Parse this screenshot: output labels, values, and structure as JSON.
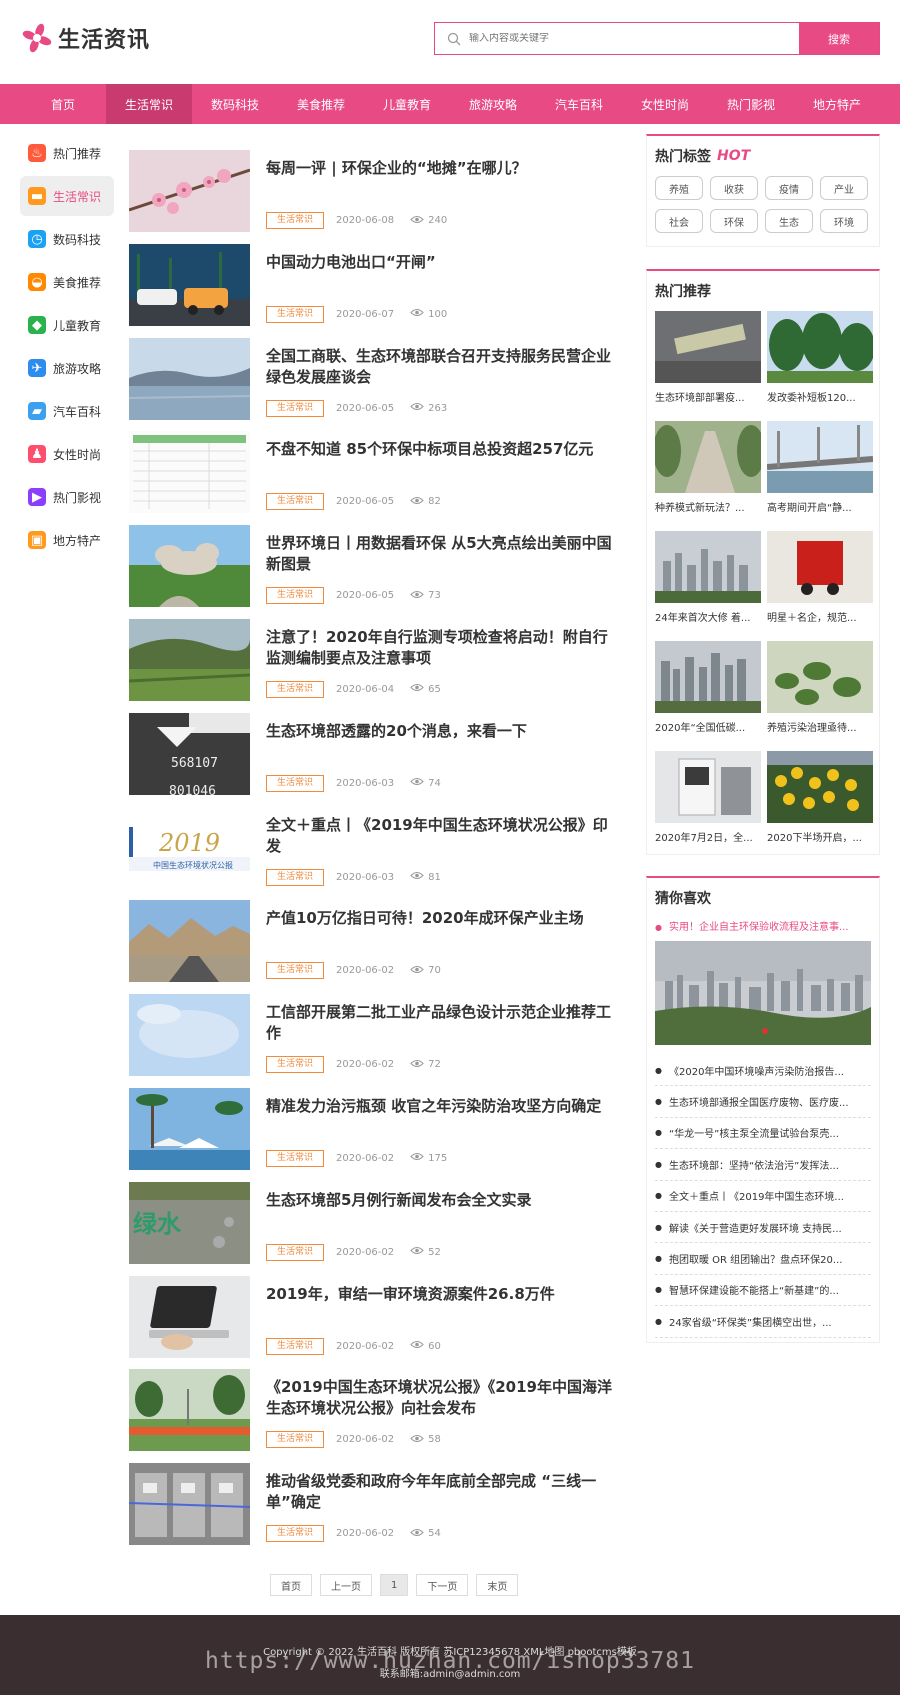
{
  "site": {
    "logo_text": "生活资讯",
    "accent": "#e84b84"
  },
  "search": {
    "placeholder": "输入内容或关键字",
    "button": "搜索"
  },
  "nav": [
    "首页",
    "生活常识",
    "数码科技",
    "美食推荐",
    "儿童教育",
    "旅游攻略",
    "汽车百科",
    "女性时尚",
    "热门影视",
    "地方特产"
  ],
  "nav_active": "生活常识",
  "sidebar": [
    {
      "label": "热门推荐",
      "icon": "flame-icon",
      "color": "#ff5a3c"
    },
    {
      "label": "生活常识",
      "icon": "sofa-icon",
      "color": "#ff9a1f"
    },
    {
      "label": "数码科技",
      "icon": "clock-icon",
      "color": "#1da1f2"
    },
    {
      "label": "美食推荐",
      "icon": "cloche-icon",
      "color": "#ff8a00"
    },
    {
      "label": "儿童教育",
      "icon": "graduation-cap-icon",
      "color": "#2bb24c"
    },
    {
      "label": "旅游攻略",
      "icon": "airplane-icon",
      "color": "#2d8cf0"
    },
    {
      "label": "汽车百科",
      "icon": "car-icon",
      "color": "#3ba0f0"
    },
    {
      "label": "女性时尚",
      "icon": "high-heel-icon",
      "color": "#ff4d6d"
    },
    {
      "label": "热门影视",
      "icon": "play-icon",
      "color": "#8a3ffc"
    },
    {
      "label": "地方特产",
      "icon": "box-icon",
      "color": "#ff9a1f"
    }
  ],
  "articles": [
    {
      "title": "每周一评 | 环保企业的“地摊”在哪儿？",
      "tag": "生活常识",
      "date": "2020-06-08",
      "views": "240"
    },
    {
      "title": "中国动力电池出口“开闸”",
      "tag": "生活常识",
      "date": "2020-06-07",
      "views": "100"
    },
    {
      "title": "全国工商联、生态环境部联合召开支持服务民营企业绿色发展座谈会",
      "tag": "生活常识",
      "date": "2020-06-05",
      "views": "263"
    },
    {
      "title": "不盘不知道 85个环保中标项目总投资超257亿元",
      "tag": "生活常识",
      "date": "2020-06-05",
      "views": "82"
    },
    {
      "title": "世界环境日丨用数据看环保 从5大亮点绘出美丽中国新图景",
      "tag": "生活常识",
      "date": "2020-06-05",
      "views": "73"
    },
    {
      "title": "注意了！2020年自行监测专项检查将启动！附自行监测编制要点及注意事项",
      "tag": "生活常识",
      "date": "2020-06-04",
      "views": "65"
    },
    {
      "title": "生态环境部透露的20个消息，来看一下",
      "tag": "生活常识",
      "date": "2020-06-03",
      "views": "74"
    },
    {
      "title": "全文＋重点丨《2019年中国生态环境状况公报》印发",
      "tag": "生活常识",
      "date": "2020-06-03",
      "views": "81"
    },
    {
      "title": "产值10万亿指日可待！2020年成环保产业主场",
      "tag": "生活常识",
      "date": "2020-06-02",
      "views": "70"
    },
    {
      "title": "工信部开展第二批工业产品绿色设计示范企业推荐工作",
      "tag": "生活常识",
      "date": "2020-06-02",
      "views": "72"
    },
    {
      "title": "精准发力治污瓶颈 收官之年污染防治攻坚方向确定",
      "tag": "生活常识",
      "date": "2020-06-02",
      "views": "175"
    },
    {
      "title": "生态环境部5月例行新闻发布会全文实录",
      "tag": "生活常识",
      "date": "2020-06-02",
      "views": "52"
    },
    {
      "title": "2019年，审结一审环境资源案件26.8万件",
      "tag": "生活常识",
      "date": "2020-06-02",
      "views": "60"
    },
    {
      "title": "《2019中国生态环境状况公报》《2019年中国海洋生态环境状况公报》向社会发布",
      "tag": "生活常识",
      "date": "2020-06-02",
      "views": "58"
    },
    {
      "title": "推动省级党委和政府今年年底前全部完成 “三线一单”确定",
      "tag": "生活常识",
      "date": "2020-06-02",
      "views": "54"
    }
  ],
  "pager": {
    "first": "首页",
    "prev": "上一页",
    "current": "1",
    "next": "下一页",
    "last": "末页"
  },
  "hot_tags": {
    "title": "热门标签",
    "hot_label": "HOT",
    "tags": [
      "养殖",
      "收获",
      "疫情",
      "产业",
      "社会",
      "环保",
      "生态",
      "环境"
    ]
  },
  "recommend": {
    "title": "热门推荐",
    "items": [
      "生态环境部部署疫...",
      "发改委补短板120...",
      "种养模式新玩法？...",
      "高考期间开启“静...",
      "24年来首次大修 着...",
      "明星＋名企，规范...",
      "2020年“全国低碳...",
      "养殖污染治理亟待...",
      "2020年7月2日，全...",
      "2020下半场开启，..."
    ]
  },
  "guess": {
    "title": "猜你喜欢",
    "first": "实用！企业自主环保验收流程及注意事...",
    "items": [
      "《2020年中国环境噪声污染防治报告...",
      "生态环境部通报全国医疗废物、医疗废...",
      "“华龙一号”核主泵全流量试验台泵壳...",
      "生态环境部：坚持“依法治污”发挥法...",
      "全文＋重点丨《2019年中国生态环境...",
      "解读《关于营造更好发展环境 支持民...",
      "抱团取暖 OR 组团输出？盘点环保20...",
      "智慧环保建设能不能搭上“新基建”的...",
      "24家省级“环保类”集团横空出世，..."
    ]
  },
  "footer": {
    "copyright": "Copyright © 2022 生活百科 版权所有   苏ICP12345678   XML地图   pbootcms模板",
    "email": "联系邮箱:admin@admin.com",
    "watermark": "https://www.huzhan.com/ishop33781"
  }
}
